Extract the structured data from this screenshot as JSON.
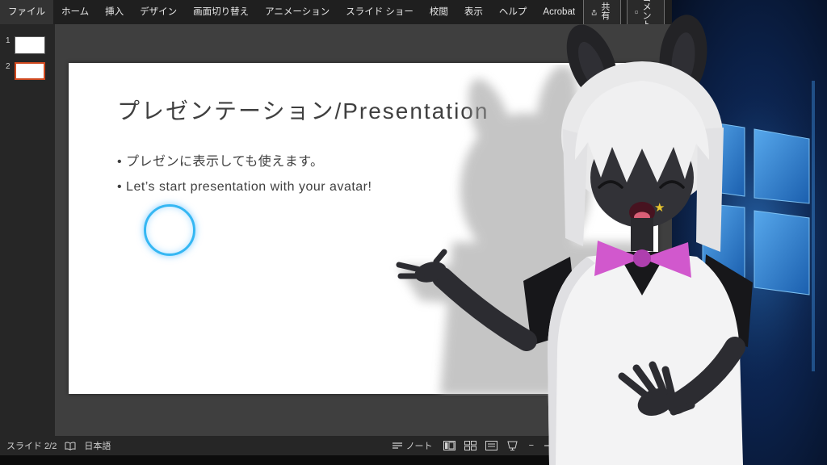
{
  "ribbon": {
    "tabs": [
      {
        "label": "ファイル"
      },
      {
        "label": "ホーム"
      },
      {
        "label": "挿入"
      },
      {
        "label": "デザイン"
      },
      {
        "label": "画面切り替え"
      },
      {
        "label": "アニメーション"
      },
      {
        "label": "スライド ショー"
      },
      {
        "label": "校閲"
      },
      {
        "label": "表示"
      },
      {
        "label": "ヘルプ"
      },
      {
        "label": "Acrobat"
      }
    ],
    "share_label": "共有",
    "comments_label": "コメント"
  },
  "slides_panel": {
    "items": [
      {
        "number": "1"
      },
      {
        "number": "2"
      }
    ],
    "selected_number": "2"
  },
  "slide": {
    "title": "プレゼンテーション/Presentation",
    "bullets": [
      {
        "text": "プレゼンに表示しても使えます。"
      },
      {
        "text": "Let’s start presentation with your avatar!"
      }
    ]
  },
  "status_bar": {
    "slide_counter": "スライド 2/2",
    "language": "日本語",
    "notes_label": "ノート",
    "zoom_out_label": "−"
  },
  "colors": {
    "selection_orange": "#d0491f",
    "pointer_blue": "#35b7f3",
    "bow_pink": "#d158cd",
    "windows_blue": "#2f7fd6"
  }
}
